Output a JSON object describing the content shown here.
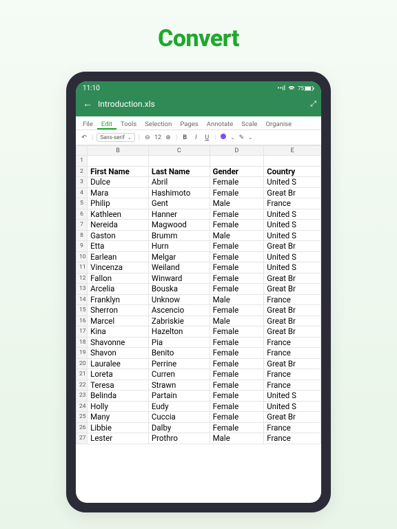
{
  "hero": {
    "title": "Convert"
  },
  "status": {
    "time": "11:10",
    "battery": "75"
  },
  "header": {
    "document_title": "Introduction.xls"
  },
  "menubar": {
    "items": [
      "File",
      "Edit",
      "Tools",
      "Selection",
      "Pages",
      "Annotate",
      "Scale",
      "Organise"
    ],
    "active_index": 1
  },
  "toolbar": {
    "font_family": "Sans-serif",
    "font_size": "12"
  },
  "sheet": {
    "col_headers": [
      "B",
      "C",
      "D",
      "E"
    ],
    "row_header_start": 1,
    "header_row": [
      "First Name",
      "Last Name",
      "Gender",
      "Country"
    ],
    "rows": [
      [
        "Dulce",
        "Abril",
        "Female",
        "United S"
      ],
      [
        "Mara",
        "Hashimoto",
        "Female",
        "Great Br"
      ],
      [
        "Philip",
        "Gent",
        "Male",
        "France"
      ],
      [
        "Kathleen",
        "Hanner",
        "Female",
        "United S"
      ],
      [
        "Nereida",
        "Magwood",
        "Female",
        "United S"
      ],
      [
        "Gaston",
        "Brumm",
        "Male",
        "United S"
      ],
      [
        "Etta",
        "Hurn",
        "Female",
        "Great Br"
      ],
      [
        "Earlean",
        "Melgar",
        "Female",
        "United S"
      ],
      [
        "Vincenza",
        "Weiland",
        "Female",
        "United S"
      ],
      [
        "Fallon",
        "Winward",
        "Female",
        "Great Br"
      ],
      [
        "Arcelia",
        "Bouska",
        "Female",
        "Great Br"
      ],
      [
        "Franklyn",
        "Unknow",
        "Male",
        "France"
      ],
      [
        "Sherron",
        "Ascencio",
        "Female",
        "Great Br"
      ],
      [
        "Marcel",
        "Zabriskie",
        "Male",
        "Great Br"
      ],
      [
        "Kina",
        "Hazelton",
        "Female",
        "Great Br"
      ],
      [
        "Shavonne",
        "Pia",
        "Female",
        "France"
      ],
      [
        "Shavon",
        "Benito",
        "Female",
        "France"
      ],
      [
        "Lauralee",
        "Perrine",
        "Female",
        "Great Br"
      ],
      [
        "Loreta",
        "Curren",
        "Female",
        "France"
      ],
      [
        "Teresa",
        "Strawn",
        "Female",
        "France"
      ],
      [
        "Belinda",
        "Partain",
        "Female",
        "United S"
      ],
      [
        "Holly",
        "Eudy",
        "Female",
        "United S"
      ],
      [
        "Many",
        "Cuccia",
        "Female",
        "Great Br"
      ],
      [
        "Libbie",
        "Dalby",
        "Female",
        "France"
      ],
      [
        "Lester",
        "Prothro",
        "Male",
        "France"
      ]
    ]
  }
}
